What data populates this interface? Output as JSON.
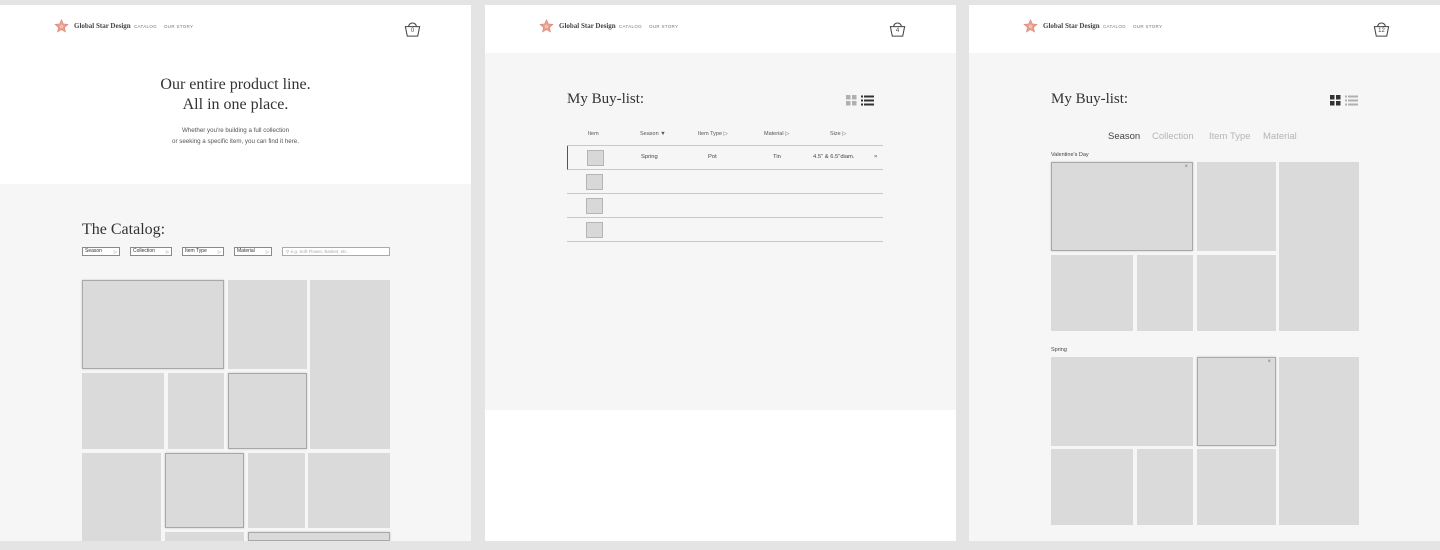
{
  "header": {
    "brand": "Global Star Design",
    "nav": [
      "CATALOG",
      "OUR STORY"
    ],
    "basket_counts": [
      "0",
      "4",
      "12"
    ]
  },
  "home": {
    "hero_title_lines": [
      "Our entire product line.",
      "All in one place."
    ],
    "hero_sub_lines": [
      "Whether you're building a full collection",
      "or seeking a specific item, you can find it here."
    ],
    "catalog_title": "The Catalog:",
    "filters": [
      "Season",
      "Collection",
      "Item Type",
      "Material"
    ],
    "search_placeholder": "e.g. Soft Flower, Basket, etc."
  },
  "buylist": {
    "title": "My Buy-list:",
    "columns": [
      "Item",
      "Season",
      "Item Type",
      "Material",
      "Size"
    ],
    "rows": [
      {
        "season": "Spring",
        "item_type": "Pot",
        "material": "Tin",
        "size": "4.5\" & 6.5\"diam.",
        "remove": "×"
      },
      {
        "season": "",
        "item_type": "",
        "material": "",
        "size": "",
        "remove": ""
      },
      {
        "season": "",
        "item_type": "",
        "material": "",
        "size": "",
        "remove": ""
      },
      {
        "season": "",
        "item_type": "",
        "material": "",
        "size": "",
        "remove": ""
      }
    ]
  },
  "gridview": {
    "title": "My Buy-list:",
    "tabs": [
      "Season",
      "Collection",
      "Item Type",
      "Material"
    ],
    "sections": [
      "Valentine's Day",
      "Spring"
    ],
    "remove_glyph": "×"
  },
  "colors": {
    "accent_logo": "#e8a090",
    "tile": "#dadada",
    "panel": "#f6f6f6",
    "tab_active": "#444444",
    "tab_inactive": "#b5b5b5"
  },
  "icons": [
    "star-logo-icon",
    "basket-icon",
    "chevron-right-icon",
    "search-icon",
    "grid-view-icon",
    "list-view-icon",
    "close-icon",
    "sort-down-icon"
  ]
}
